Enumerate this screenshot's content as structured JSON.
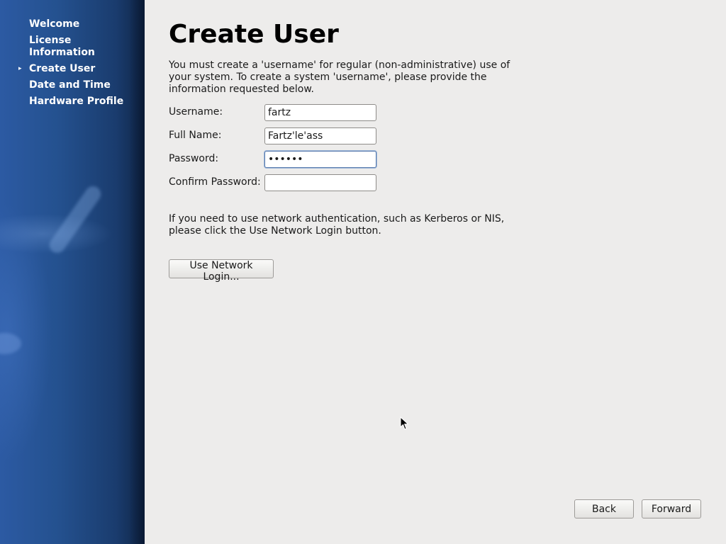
{
  "sidebar": {
    "items": [
      {
        "label": "Welcome",
        "current": false
      },
      {
        "label": "License Information",
        "current": false
      },
      {
        "label": "Create User",
        "current": true
      },
      {
        "label": "Date and Time",
        "current": false
      },
      {
        "label": "Hardware Profile",
        "current": false
      }
    ],
    "current_marker": "▸"
  },
  "main": {
    "title": "Create User",
    "intro": "You must create a 'username' for regular (non-administrative) use of your system.  To create a system 'username', please provide the information requested below.",
    "fields": {
      "username": {
        "label": "Username:",
        "value": "fartz"
      },
      "full_name": {
        "label": "Full Name:",
        "value": "Fartz'le'ass"
      },
      "password": {
        "label": "Password:",
        "value": "••••••"
      },
      "confirm_password": {
        "label": "Confirm Password:",
        "value": ""
      }
    },
    "network_note": "If you need to use network authentication, such as Kerberos or NIS, please click the Use Network Login button.",
    "network_button_label": "Use Network Login..."
  },
  "footer": {
    "back_label": "Back",
    "forward_label": "Forward"
  },
  "colors": {
    "sidebar_blue": "#24518f",
    "background": "#edeceb",
    "focus_border": "#5a7cae"
  }
}
